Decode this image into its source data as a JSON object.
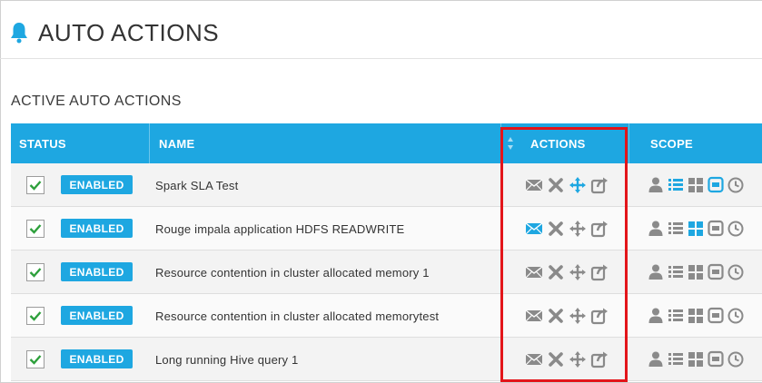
{
  "page": {
    "title": "AUTO ACTIONS"
  },
  "section": {
    "title": "ACTIVE AUTO ACTIONS"
  },
  "table": {
    "columns": {
      "status": "STATUS",
      "name": "NAME",
      "actions": "ACTIONS",
      "scope": "SCOPE"
    },
    "rows": [
      {
        "status": "ENABLED",
        "name": "Spark SLA Test",
        "checked": true,
        "email_active": false,
        "move_active": true,
        "scope_active": [
          "list",
          "queue"
        ]
      },
      {
        "status": "ENABLED",
        "name": "Rouge impala application HDFS READWRITE",
        "checked": true,
        "email_active": true,
        "move_active": false,
        "scope_active": [
          "grid"
        ]
      },
      {
        "status": "ENABLED",
        "name": "Resource contention in cluster allocated memory 1",
        "checked": true,
        "email_active": false,
        "move_active": false,
        "scope_active": []
      },
      {
        "status": "ENABLED",
        "name": "Resource contention in cluster allocated memorytest",
        "checked": true,
        "email_active": false,
        "move_active": false,
        "scope_active": []
      },
      {
        "status": "ENABLED",
        "name": "Long running Hive query 1",
        "checked": true,
        "email_active": false,
        "move_active": false,
        "scope_active": []
      }
    ]
  },
  "colors": {
    "accent": "#1ea7e1",
    "icon_gray": "#8a8a8a",
    "highlight": "#e3151a"
  },
  "icons": {
    "actions": [
      "email-icon",
      "delete-icon",
      "move-icon",
      "share-icon"
    ],
    "scope": [
      "user-icon",
      "list-icon",
      "grid-icon",
      "queue-icon",
      "clock-icon"
    ]
  }
}
